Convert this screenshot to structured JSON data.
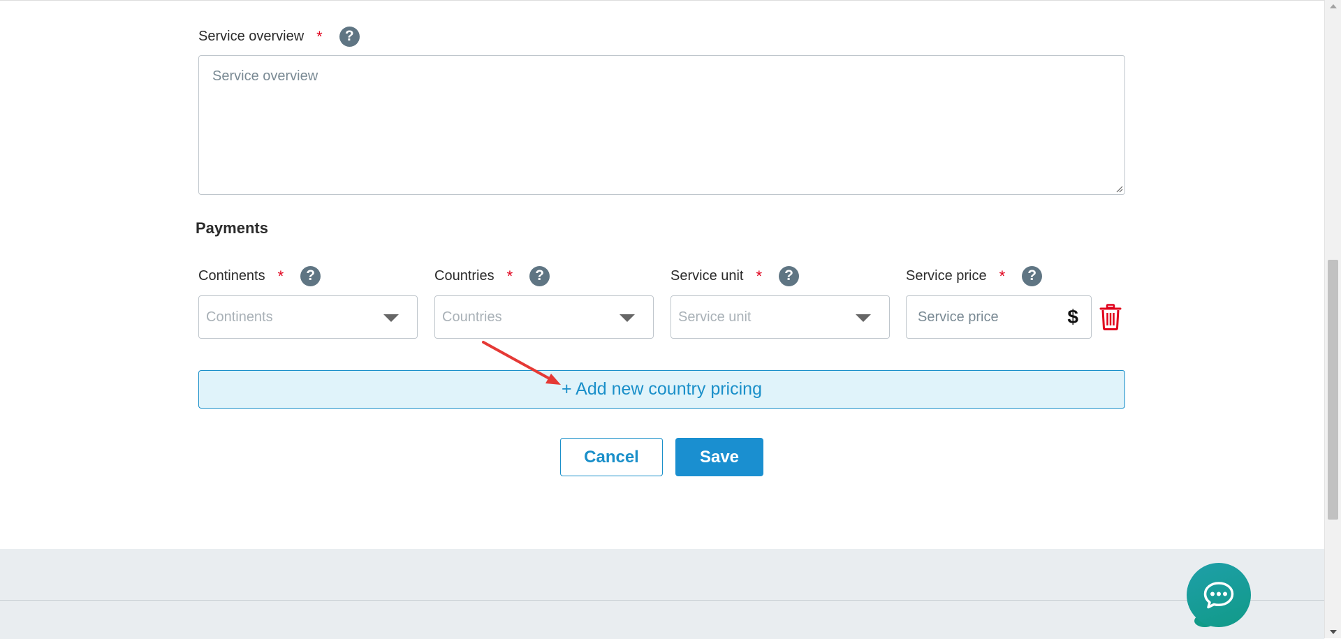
{
  "service_overview": {
    "label": "Service overview",
    "required_mark": "*",
    "help_icon": "?",
    "placeholder": "Service overview"
  },
  "payments": {
    "title": "Payments",
    "continents": {
      "label": "Continents",
      "required_mark": "*",
      "help_icon": "?",
      "placeholder": "Continents"
    },
    "countries": {
      "label": "Countries",
      "required_mark": "*",
      "help_icon": "?",
      "placeholder": "Countries"
    },
    "service_unit": {
      "label": "Service unit",
      "required_mark": "*",
      "help_icon": "?",
      "placeholder": "Service unit"
    },
    "service_price": {
      "label": "Service price",
      "required_mark": "*",
      "help_icon": "?",
      "placeholder": "Service price",
      "currency_symbol": "$"
    },
    "add_country_label": "+ Add new country pricing"
  },
  "actions": {
    "cancel_label": "Cancel",
    "save_label": "Save"
  },
  "colors": {
    "accent": "#1a8fc9",
    "required": "#e0001b",
    "delete": "#e0001b",
    "annotation_arrow": "#e53935",
    "chat": "#119a88"
  },
  "icons": {
    "help": "question-circle-icon",
    "dropdown": "caret-down-icon",
    "currency": "dollar-icon",
    "delete": "trash-icon",
    "chat": "chat-bubble-icon"
  }
}
